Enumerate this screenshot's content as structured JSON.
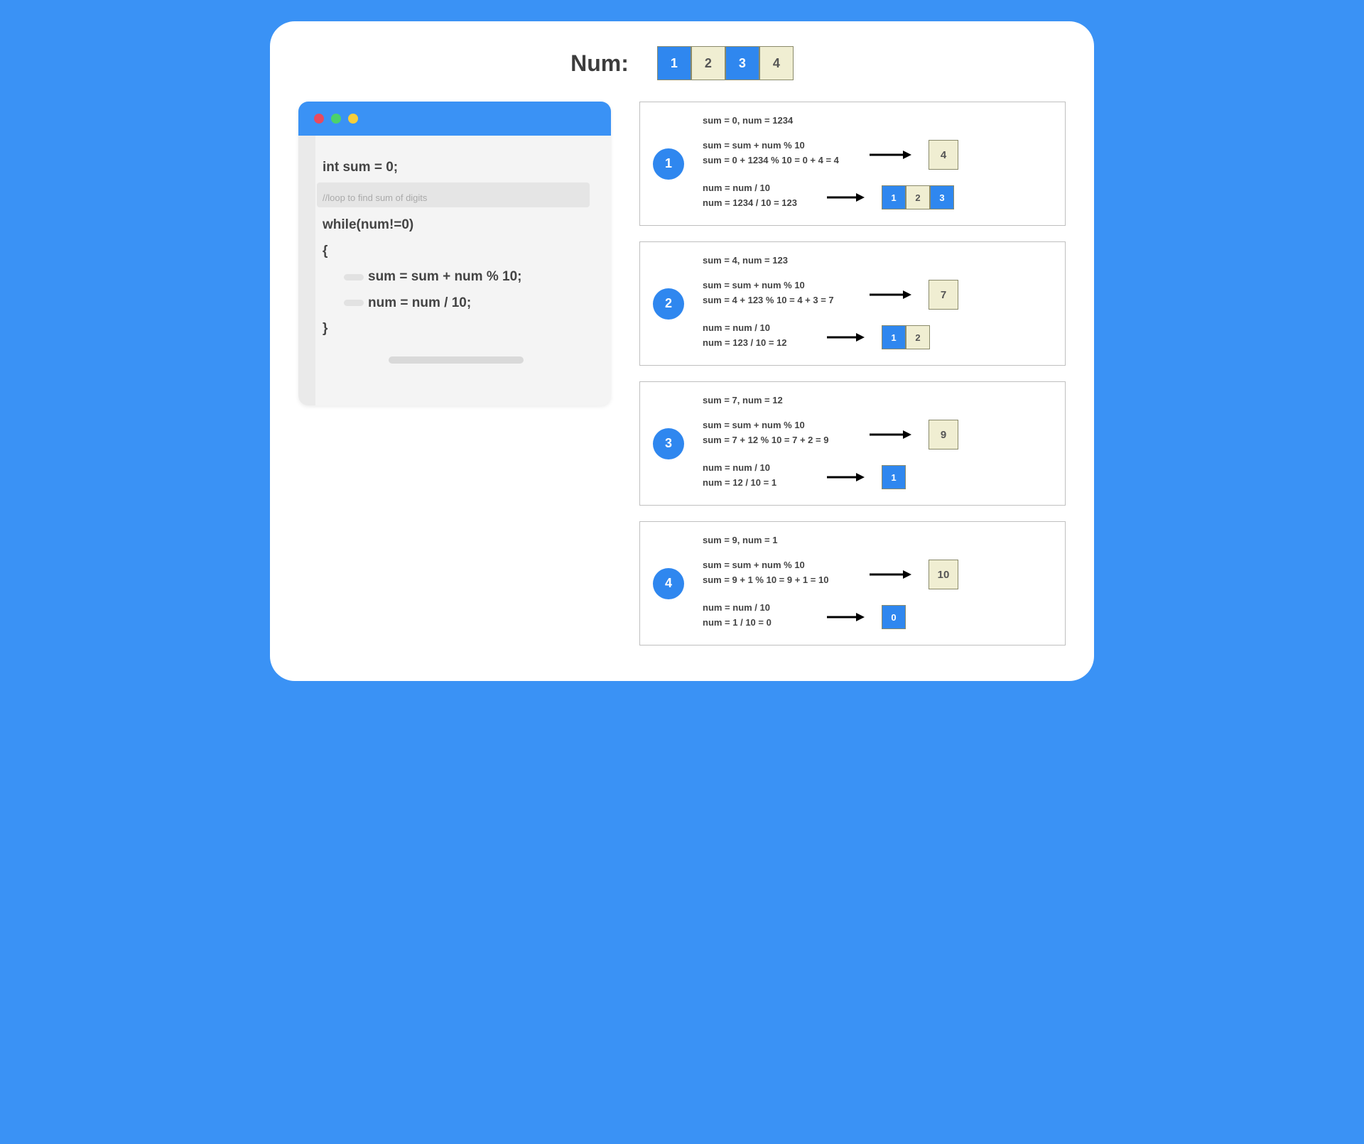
{
  "header": {
    "label": "Num:",
    "digits": [
      {
        "v": "1",
        "c": "blue"
      },
      {
        "v": "2",
        "c": "cream"
      },
      {
        "v": "3",
        "c": "blue"
      },
      {
        "v": "4",
        "c": "cream"
      }
    ]
  },
  "code": {
    "line1": "int sum = 0;",
    "comment": "//loop to find sum of digits",
    "line2": "while(num!=0)",
    "line3": "{",
    "line4": "sum  = sum + num % 10;",
    "line5": "num = num / 10;",
    "line6": "}"
  },
  "steps": [
    {
      "num": "1",
      "top_state": "sum = 0, num = 1234",
      "sum_formula": "sum = sum + num % 10",
      "sum_calc": "sum = 0 + 1234 % 10 = 0 + 4 = 4",
      "sum_result": "4",
      "num_formula": "num = num / 10",
      "num_calc": "num = 1234 / 10 = 123",
      "num_digits": [
        {
          "v": "1",
          "c": "blue"
        },
        {
          "v": "2",
          "c": "cream"
        },
        {
          "v": "3",
          "c": "blue"
        }
      ]
    },
    {
      "num": "2",
      "top_state": "sum = 4, num = 123",
      "sum_formula": "sum = sum + num % 10",
      "sum_calc": "sum = 4 + 123 % 10 = 4 + 3 = 7",
      "sum_result": "7",
      "num_formula": "num = num / 10",
      "num_calc": "num = 123 / 10 = 12",
      "num_digits": [
        {
          "v": "1",
          "c": "blue"
        },
        {
          "v": "2",
          "c": "cream"
        }
      ]
    },
    {
      "num": "3",
      "top_state": "sum = 7, num = 12",
      "sum_formula": "sum = sum + num % 10",
      "sum_calc": "sum = 7 + 12 % 10 = 7 + 2 = 9",
      "sum_result": "9",
      "num_formula": "num = num / 10",
      "num_calc": "num = 12 / 10 = 1",
      "num_digits": [
        {
          "v": "1",
          "c": "blue"
        }
      ]
    },
    {
      "num": "4",
      "top_state": "sum = 9, num = 1",
      "sum_formula": "sum = sum + num % 10",
      "sum_calc": "sum = 9 + 1 % 10 = 9 + 1 = 10",
      "sum_result": "10",
      "num_formula": "num = num / 10",
      "num_calc": "num = 1 / 10 = 0",
      "num_digits": [
        {
          "v": "0",
          "c": "blue"
        }
      ]
    }
  ]
}
